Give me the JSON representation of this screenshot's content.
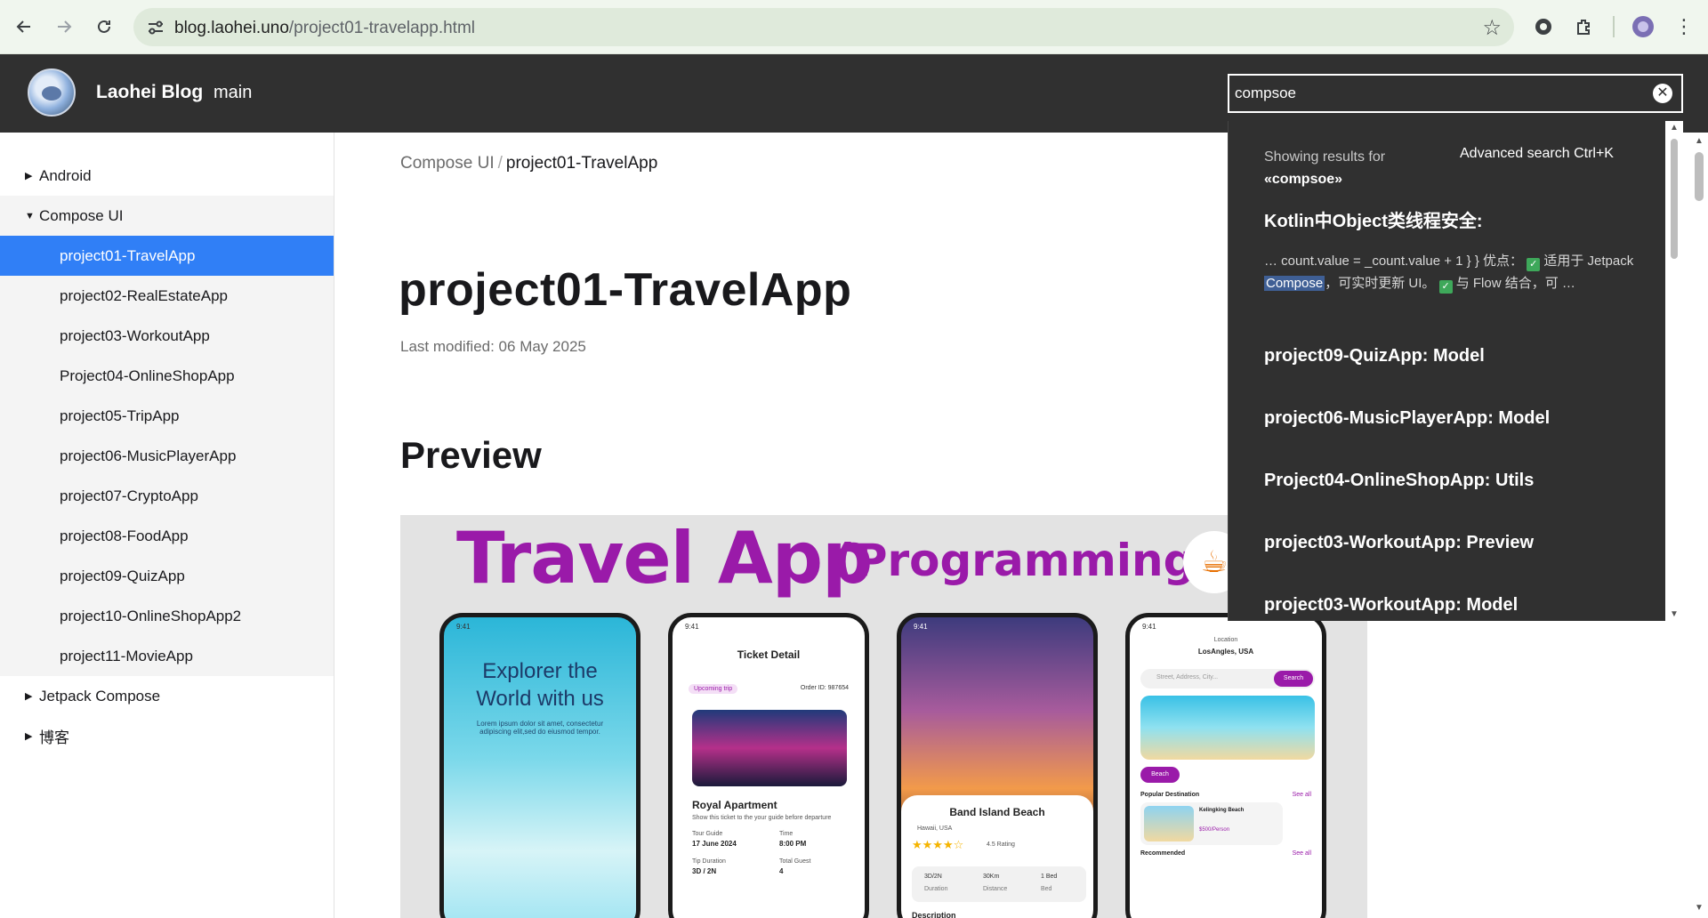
{
  "browser": {
    "url_host": "blog.laohei.uno",
    "url_path": "/project01-travelapp.html"
  },
  "header": {
    "brand": "Laohei Blog",
    "subtitle": "main",
    "search_value": "compsoe",
    "clear_label": "✕"
  },
  "sidebar": {
    "items": [
      {
        "label": "Android",
        "arrow": "▶"
      },
      {
        "label": "Compose UI",
        "arrow": "▼"
      },
      {
        "label": "project01-TravelApp"
      },
      {
        "label": "project02-RealEstateApp"
      },
      {
        "label": "project03-WorkoutApp"
      },
      {
        "label": "Project04-OnlineShopApp"
      },
      {
        "label": "project05-TripApp"
      },
      {
        "label": "project06-MusicPlayerApp"
      },
      {
        "label": "project07-CryptoApp"
      },
      {
        "label": "project08-FoodApp"
      },
      {
        "label": "project09-QuizApp"
      },
      {
        "label": "project10-OnlineShopApp2"
      },
      {
        "label": "project11-MovieApp"
      },
      {
        "label": "Jetpack Compose",
        "arrow": "▶"
      },
      {
        "label": "博客",
        "arrow": "▶"
      }
    ]
  },
  "main": {
    "breadcrumb_parent": "Compose UI",
    "breadcrumb_sep": "/",
    "breadcrumb_current": "project01-TravelApp",
    "title": "project01-TravelApp",
    "last_modified": "Last modified: 06 May 2025",
    "section_title": "Preview"
  },
  "preview": {
    "title": "Travel App",
    "subtitle": "(Programming)",
    "phone1": {
      "time": "9:41",
      "headline_1": "Explorer the",
      "headline_2": "World with us",
      "subtext": "Lorem ipsum dolor sit amet, consectetur adipiscing elit,sed do eiusmod tempor."
    },
    "phone2": {
      "time": "9:41",
      "header": "Ticket Detail",
      "tag": "Upcoming trip",
      "order": "Order ID: 987654",
      "name": "Royal Apartment",
      "note": "Show this ticket to the your guide before departure",
      "guide_label": "Tour Guide",
      "guide_value": "17 June 2024",
      "time_label": "Time",
      "time_value": "8:00 PM",
      "duration_label": "Tip Duration",
      "duration_value": "3D / 2N",
      "guest_label": "Total Guest",
      "guest_value": "4"
    },
    "phone3": {
      "time": "9:41",
      "title": "Band Island Beach",
      "location": "Hawaii, USA",
      "stars": "★★★★☆",
      "rating": "4.5 Rating",
      "chip1": "3D/2N",
      "chip1_label": "Duration",
      "chip2": "30Km",
      "chip2_label": "Distance",
      "chip3": "1 Bed",
      "chip3_label": "Bed",
      "desc": "Description"
    },
    "phone4": {
      "time": "9:41",
      "location_label": "Location",
      "city": "LosAngles, USA",
      "search_placeholder": "Street, Address, City...",
      "search_btn": "Search",
      "popular": "Popular Destination",
      "see_all": "See all",
      "card_title": "Kelingking Beach",
      "card_price": "$500/Person",
      "recommended": "Recommended",
      "chip": "Beach"
    }
  },
  "search_results": {
    "showing_prefix": "Showing results for",
    "query_display": "«compsoe»",
    "advanced": "Advanced search Ctrl+K",
    "top_title": "Kotlin中Object类线程安全:",
    "snippet_1": "… count.value = _count.value + 1 } } 优点：",
    "snippet_2": "适用于",
    "snippet_3": "Jetpack",
    "snippet_hl": "Compose",
    "snippet_4": "，可实时更新 UI。",
    "snippet_5": "与 Flow 结合，可 …",
    "others": [
      "project09-QuizApp: Model",
      "project06-MusicPlayerApp: Model",
      "Project04-OnlineShopApp: Utils",
      "project03-WorkoutApp: Preview",
      "project03-WorkoutApp: Model"
    ]
  }
}
